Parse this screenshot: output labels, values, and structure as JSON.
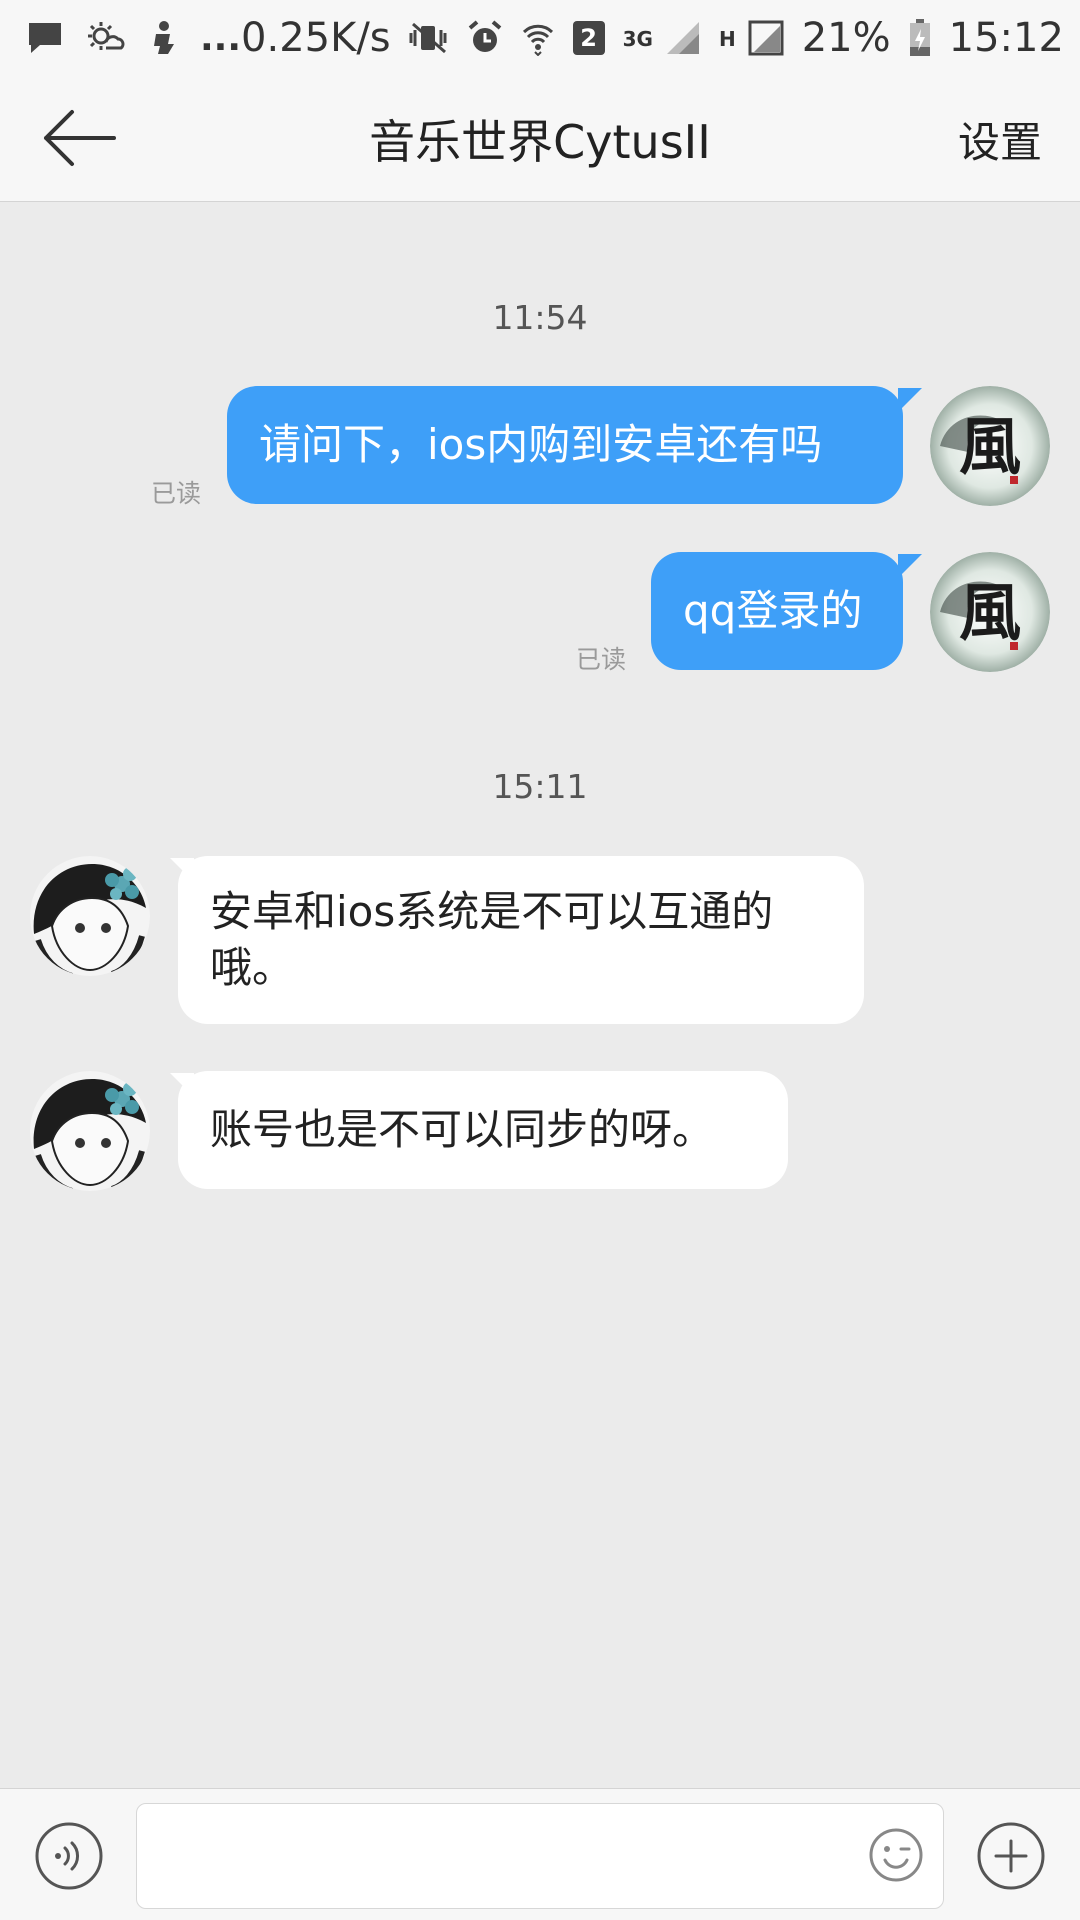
{
  "status_bar": {
    "net_speed": "0.25K/s",
    "sim_badge": "2",
    "signal_3g": "3G",
    "signal_h": "H",
    "battery_pct": "21%",
    "clock": "15:12",
    "dots": "..."
  },
  "header": {
    "title": "音乐世界CytusII",
    "settings_label": "设置"
  },
  "conversation": {
    "groups": [
      {
        "timestamp": "11:54",
        "messages": [
          {
            "direction": "outgoing",
            "text": "请问下，ios内购到安卓还有吗",
            "read_label": "已读"
          },
          {
            "direction": "outgoing",
            "text": "qq登录的",
            "read_label": "已读"
          }
        ]
      },
      {
        "timestamp": "15:11",
        "messages": [
          {
            "direction": "incoming",
            "text_line1": "安卓和ios系统是不可以互通的",
            "text_line2": "哦。"
          },
          {
            "direction": "incoming",
            "text": "账号也是不可以同步的呀。"
          }
        ]
      }
    ],
    "self_avatar_char": "風"
  },
  "input_bar": {
    "placeholder": ""
  },
  "colors": {
    "outgoing_bubble": "#3e9ff8",
    "incoming_bubble": "#ffffff",
    "chat_background": "#ebebeb"
  },
  "icons": {
    "back": "arrow-left-icon",
    "voice": "voice-icon",
    "emoji": "emoji-icon",
    "plus": "plus-icon"
  }
}
